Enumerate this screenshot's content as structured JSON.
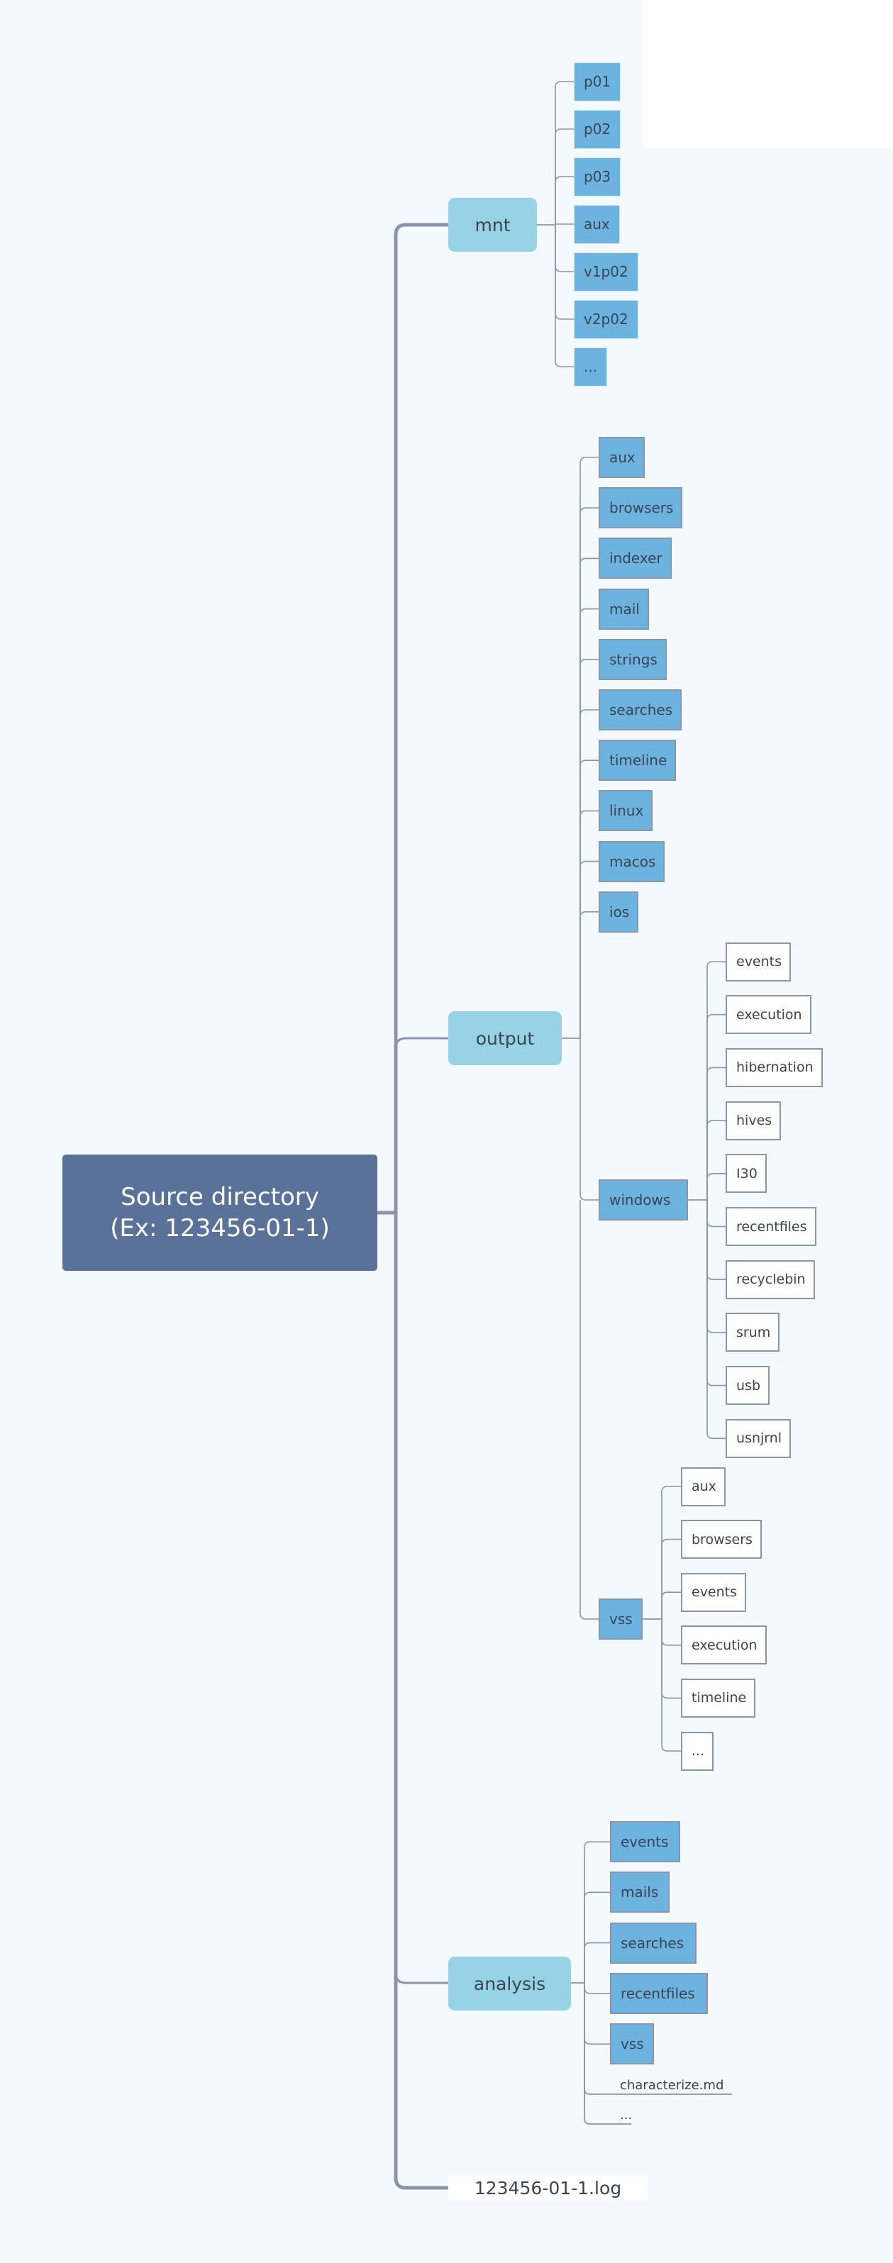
{
  "root": {
    "label_line1": "Source directory",
    "label_line2": "(Ex: 123456-01-1)"
  },
  "colors": {
    "background": "#F3F9FE",
    "root": "#5A7299",
    "level1": "#98D2E7",
    "level2": "#6DB3E0",
    "connector": "#8996A9"
  },
  "branches": {
    "mnt": {
      "label": "mnt",
      "children": [
        "p01",
        "p02",
        "p03",
        "aux",
        "v1p02",
        "v2p02",
        "..."
      ]
    },
    "output": {
      "label": "output",
      "children": [
        "aux",
        "browsers",
        "indexer",
        "mail",
        "strings",
        "searches",
        "timeline",
        "linux",
        "macos",
        "ios"
      ],
      "windows": {
        "label": "windows",
        "children": [
          "events",
          "execution",
          "hibernation",
          "hives",
          "I30",
          "recentfiles",
          "recyclebin",
          "srum",
          "usb",
          "usnjrnl"
        ]
      },
      "vss": {
        "label": "vss",
        "children": [
          "aux",
          "browsers",
          "events",
          "execution",
          "timeline",
          "..."
        ]
      }
    },
    "analysis": {
      "label": "analysis",
      "children": [
        "events",
        "mails",
        "searches",
        "recentfiles",
        "vss"
      ],
      "files": [
        "characterize.md",
        "..."
      ]
    },
    "log": {
      "label": "123456-01-1.log"
    }
  }
}
